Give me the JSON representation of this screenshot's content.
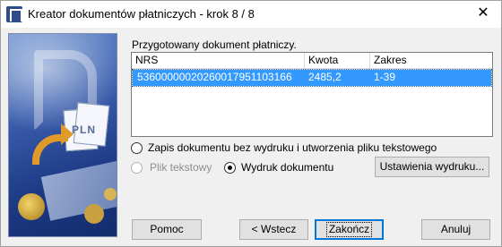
{
  "window": {
    "title": "Kreator dokumentów płatniczych - krok 8 / 8",
    "close_glyph": "✕"
  },
  "banner": {
    "pln_text": "PLN"
  },
  "panel": {
    "label": "Przygotowany dokument płatniczy.",
    "columns": [
      "NRS",
      "Kwota",
      "Zakres"
    ],
    "rows": [
      {
        "nrs": "53600000020260017951103166",
        "kwota": "2485,2",
        "zakres": "1-39"
      }
    ]
  },
  "options": {
    "save_no_print": "Zapis dokumentu bez wydruku i utworzenia pliku tekstowego",
    "text_file": "Plik tekstowy",
    "print_doc": "Wydruk dokumentu",
    "selected": "print_doc"
  },
  "buttons": {
    "print_settings": "Ustawienia wydruku...",
    "help": "Pomoc",
    "back": "< Wstecz",
    "finish": "Zakończ",
    "cancel": "Anuluj"
  },
  "colors": {
    "selection": "#3399ff",
    "default_button_border": "#0078d7",
    "app_icon": "#2d4a8a",
    "arrow": "#e09a2a"
  },
  "icons": [
    "app-icon",
    "close-icon"
  ]
}
